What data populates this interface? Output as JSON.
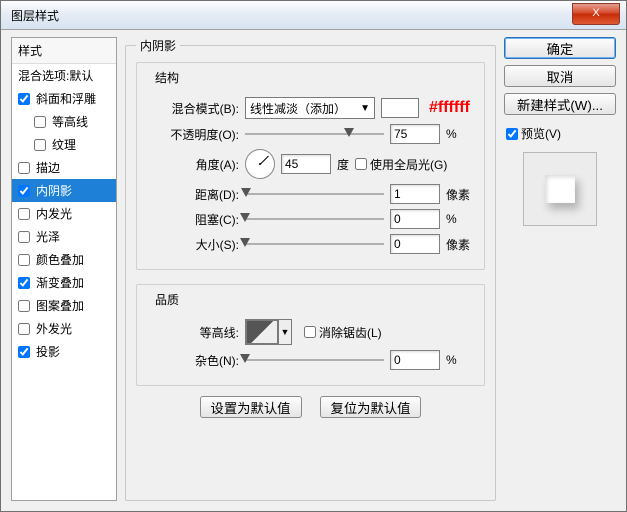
{
  "title": "图层样式",
  "close_x": "X",
  "styles": {
    "header": "样式",
    "blend_defaults": "混合选项:默认",
    "items": [
      {
        "label": "斜面和浮雕",
        "checked": true
      },
      {
        "label": "等高线",
        "checked": false,
        "sub": true
      },
      {
        "label": "纹理",
        "checked": false,
        "sub": true
      },
      {
        "label": "描边",
        "checked": false
      },
      {
        "label": "内阴影",
        "checked": true,
        "selected": true
      },
      {
        "label": "内发光",
        "checked": false
      },
      {
        "label": "光泽",
        "checked": false
      },
      {
        "label": "颜色叠加",
        "checked": false
      },
      {
        "label": "渐变叠加",
        "checked": true
      },
      {
        "label": "图案叠加",
        "checked": false
      },
      {
        "label": "外发光",
        "checked": false
      },
      {
        "label": "投影",
        "checked": true
      }
    ]
  },
  "panel_title": "内阴影",
  "structure": {
    "title": "结构",
    "blend_mode_label": "混合模式(B):",
    "blend_mode_value": "线性减淡（添加）",
    "color_hex": "#ffffff",
    "opacity_label": "不透明度(O):",
    "opacity_value": "75",
    "opacity_unit": "%",
    "angle_label": "角度(A):",
    "angle_value": "45",
    "angle_unit": "度",
    "global_light_label": "使用全局光(G)",
    "distance_label": "距离(D):",
    "distance_value": "1",
    "distance_unit": "像素",
    "choke_label": "阻塞(C):",
    "choke_value": "0",
    "choke_unit": "%",
    "size_label": "大小(S):",
    "size_value": "0",
    "size_unit": "像素"
  },
  "quality": {
    "title": "品质",
    "contour_label": "等高线:",
    "antialias_label": "消除锯齿(L)",
    "noise_label": "杂色(N):",
    "noise_value": "0",
    "noise_unit": "%"
  },
  "buttons": {
    "make_default": "设置为默认值",
    "reset_default": "复位为默认值",
    "ok": "确定",
    "cancel": "取消",
    "new_style": "新建样式(W)...",
    "preview": "预览(V)"
  }
}
